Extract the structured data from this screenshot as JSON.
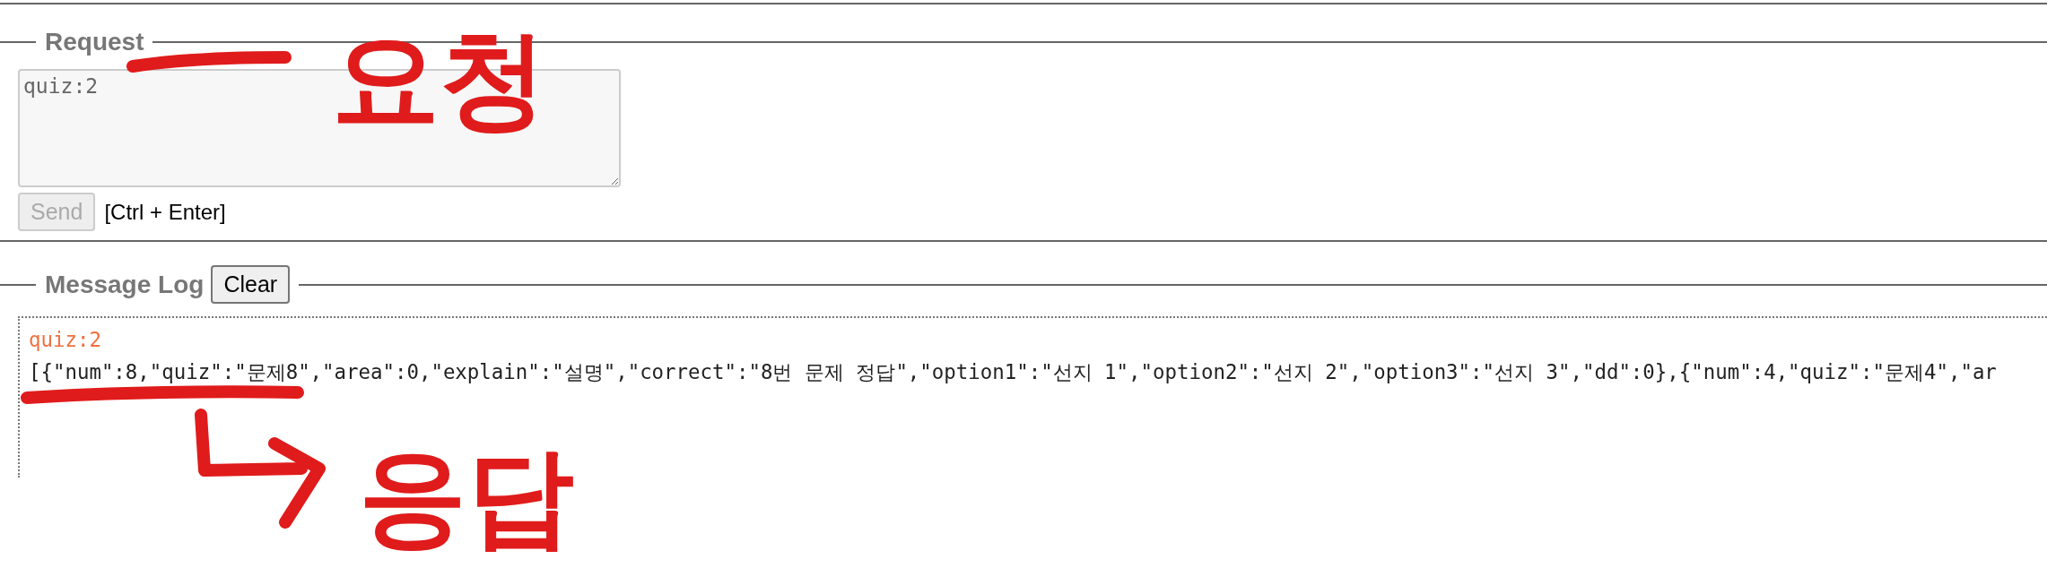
{
  "request": {
    "legend": "Request",
    "value": "quiz:2",
    "send": {
      "label": "Send",
      "disabled": true
    },
    "hint": "[Ctrl + Enter]"
  },
  "message_log": {
    "legend": "Message Log",
    "clear": "Clear",
    "entries": [
      {
        "kind": "sent",
        "text": "quiz:2"
      },
      {
        "kind": "received",
        "text": "[{\"num\":8,\"quiz\":\"문제8\",\"area\":0,\"explain\":\"설명\",\"correct\":\"8번 문제 정답\",\"option1\":\"선지 1\",\"option2\":\"선지 2\",\"option3\":\"선지 3\",\"dd\":0},{\"num\":4,\"quiz\":\"문제4\",\"ar"
      }
    ]
  },
  "annotations": [
    {
      "kind": "request",
      "text": "요청"
    },
    {
      "kind": "response",
      "text": "응답"
    }
  ]
}
